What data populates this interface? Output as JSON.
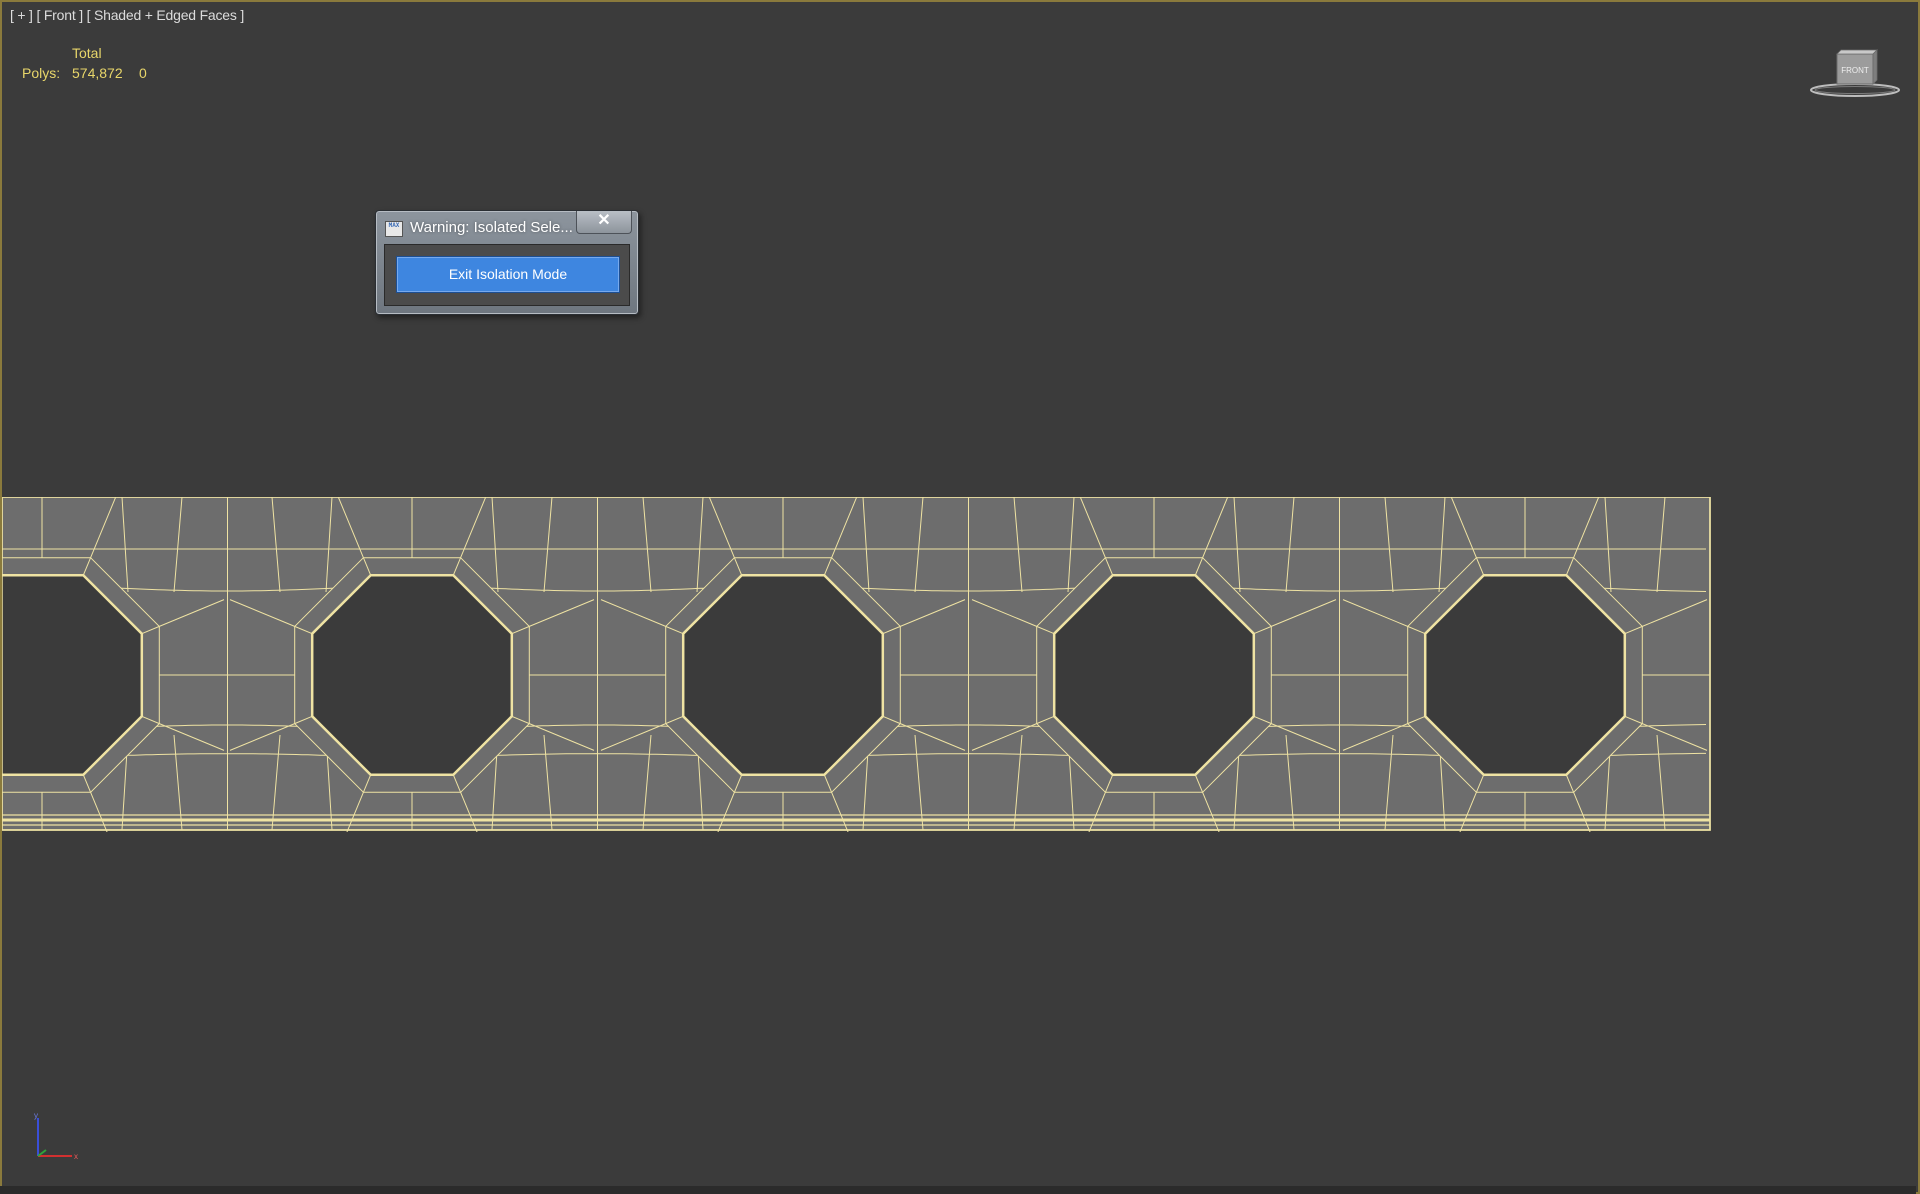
{
  "viewport": {
    "label_plus": "[ + ]",
    "label_view": "[ Front ]",
    "label_shading": "[ Shaded + Edged Faces ]"
  },
  "stats": {
    "header": "Total",
    "polys_label": "Polys:",
    "polys_total": "574,872",
    "polys_selected": "0"
  },
  "viewcube": {
    "face_label": "FRONT"
  },
  "dialog": {
    "title": "Warning: Isolated Sele...",
    "close_glyph": "✕",
    "app_icon_text": "MAX",
    "button_label": "Exit Isolation Mode"
  },
  "axis": {
    "y_label": "y",
    "x_label": "x"
  },
  "colors": {
    "wire": "#efe3a3",
    "face": "#6d6d6d",
    "background": "#3b3b3b",
    "stats_text": "#e8d66a",
    "button": "#3e86e0"
  }
}
